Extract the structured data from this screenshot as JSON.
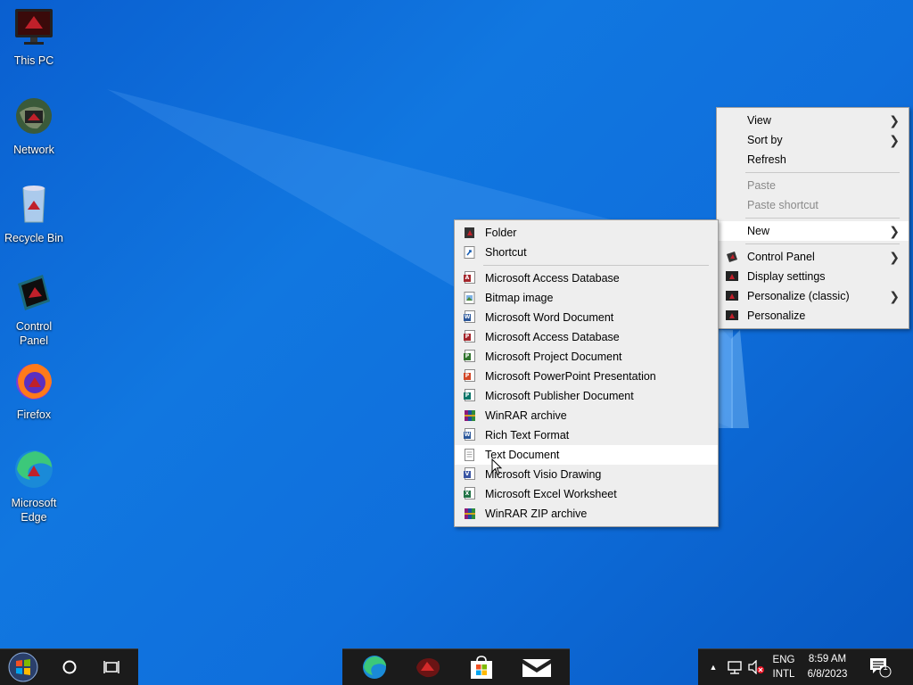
{
  "desktop": {
    "icons": [
      {
        "label": "This PC"
      },
      {
        "label": "Network"
      },
      {
        "label": "Recycle Bin"
      },
      {
        "label": "Control\nPanel"
      },
      {
        "label": "Firefox"
      },
      {
        "label": "Microsoft\nEdge"
      }
    ]
  },
  "context_menu": {
    "items": [
      {
        "label": "View"
      },
      {
        "label": "Sort by"
      },
      {
        "label": "Refresh"
      },
      {
        "label": "Paste"
      },
      {
        "label": "Paste shortcut"
      },
      {
        "label": "New"
      },
      {
        "label": "Control Panel"
      },
      {
        "label": "Display settings"
      },
      {
        "label": "Personalize (classic)"
      },
      {
        "label": "Personalize"
      }
    ]
  },
  "new_submenu": {
    "items": [
      {
        "label": "Folder"
      },
      {
        "label": "Shortcut"
      },
      {
        "label": "Microsoft Access Database"
      },
      {
        "label": "Bitmap image"
      },
      {
        "label": "Microsoft Word Document"
      },
      {
        "label": "Microsoft Access Database"
      },
      {
        "label": "Microsoft Project Document"
      },
      {
        "label": "Microsoft PowerPoint Presentation"
      },
      {
        "label": "Microsoft Publisher Document"
      },
      {
        "label": "WinRAR archive"
      },
      {
        "label": "Rich Text Format"
      },
      {
        "label": "Text Document"
      },
      {
        "label": "Microsoft Visio Drawing"
      },
      {
        "label": "Microsoft Excel Worksheet"
      },
      {
        "label": "WinRAR ZIP archive"
      }
    ]
  },
  "taskbar": {
    "lang_line1": "ENG",
    "lang_line2": "INTL",
    "time": "8:59 AM",
    "date": "6/8/2023",
    "notification_count": "1"
  },
  "colors": {
    "accent": "#0f6fdc",
    "menu_bg": "#eeeeee",
    "taskbar_bg": "#1b1b1b"
  }
}
